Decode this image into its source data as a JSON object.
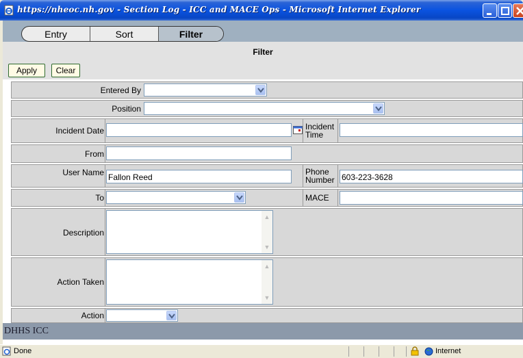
{
  "window": {
    "title": "https://nheoc.nh.gov - Section Log - ICC and MACE Ops - Microsoft Internet Explorer"
  },
  "tabs": [
    {
      "label": "Entry"
    },
    {
      "label": "Sort"
    },
    {
      "label": "Filter",
      "active": true
    }
  ],
  "section_title": "Filter",
  "buttons": {
    "apply": "Apply",
    "clear": "Clear"
  },
  "form": {
    "entered_by": {
      "label": "Entered By",
      "value": ""
    },
    "position": {
      "label": "Position",
      "value": ""
    },
    "incident_date": {
      "label": "Incident Date",
      "value": ""
    },
    "incident_time": {
      "label_line1": "Incident",
      "label_line2": "Time",
      "value": ""
    },
    "from": {
      "label": "From",
      "value": ""
    },
    "user_name": {
      "label": "User Name",
      "value": "Fallon Reed"
    },
    "phone_number": {
      "label_line1": "Phone",
      "label_line2": "Number",
      "value": "603-223-3628"
    },
    "to": {
      "label": "To",
      "value": ""
    },
    "mace": {
      "label": "MACE",
      "value": ""
    },
    "description": {
      "label": "Description",
      "value": ""
    },
    "action_taken": {
      "label": "Action Taken",
      "value": ""
    },
    "action": {
      "label": "Action",
      "value": ""
    }
  },
  "footer_band": "DHHS ICC",
  "status": {
    "text": "Done",
    "zone": "Internet"
  },
  "colors": {
    "title_bar": "#0a53e0",
    "tab_bar": "#9fb0c0",
    "row_bg": "#d8d8d8",
    "footer_band": "#8c99aa"
  }
}
